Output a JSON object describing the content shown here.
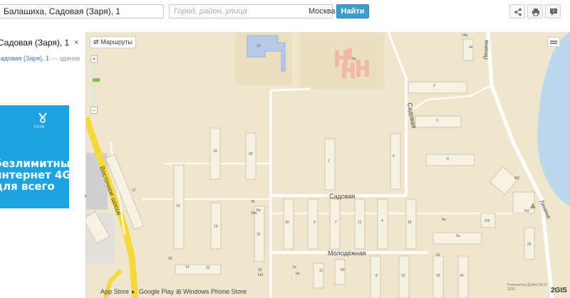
{
  "search": {
    "address_value": "Балашиха, Садовая (Заря), 1",
    "city_placeholder": "Город, район, улица",
    "city_label": "Москва",
    "find_label": "Найти"
  },
  "toolbar": {
    "share_icon": "share-icon",
    "print_icon": "print-icon",
    "feedback_icon": "feedback-icon"
  },
  "panel": {
    "title": "Садовая (Заря), 1",
    "close_label": "×",
    "sub_street": "Садовая (Заря),",
    "sub_num": "1",
    "sub_meta": "— здание",
    "ad": {
      "logo": "YOTA",
      "lines": [
        "безлимитный",
        "интернет 4G",
        "для всего"
      ]
    }
  },
  "map": {
    "routes_label": "Маршруты",
    "streets": {
      "sadovaya_h": "Садовая",
      "sadovaya_v": "Садовая",
      "molodezhnaya": "Молодёжная",
      "vostochnoe": "Восточное шоссе",
      "lenina": "Ленина"
    },
    "house_numbers": [
      "10",
      "19",
      "20",
      "1",
      "2",
      "3",
      "4",
      "5",
      "6",
      "7",
      "8",
      "9",
      "10",
      "12",
      "14",
      "15",
      "16",
      "17",
      "18",
      "21",
      "22",
      "23",
      "24",
      "25",
      "26",
      "34",
      "35",
      "36",
      "5а",
      "6а",
      "7а",
      "8а",
      "14а",
      "4/2",
      "4а",
      "11",
      "13",
      "46",
      "7к2",
      "2/4",
      "6к1",
      "34а",
      "6б",
      "9а",
      "21а"
    ],
    "stores": [
      "App Store",
      "Google Play",
      "Windows Phone Store"
    ],
    "attribution": "Powered by ДубльГИС© 2GIS",
    "brand": "2GIS"
  },
  "colors": {
    "accent": "#3c9dd0",
    "ad_bg": "#1fa2e0",
    "land": "#efe6cd",
    "building": "#f5f1e3",
    "road": "#ffffff",
    "highway": "#f4d83c",
    "water": "#bcd8ec"
  }
}
